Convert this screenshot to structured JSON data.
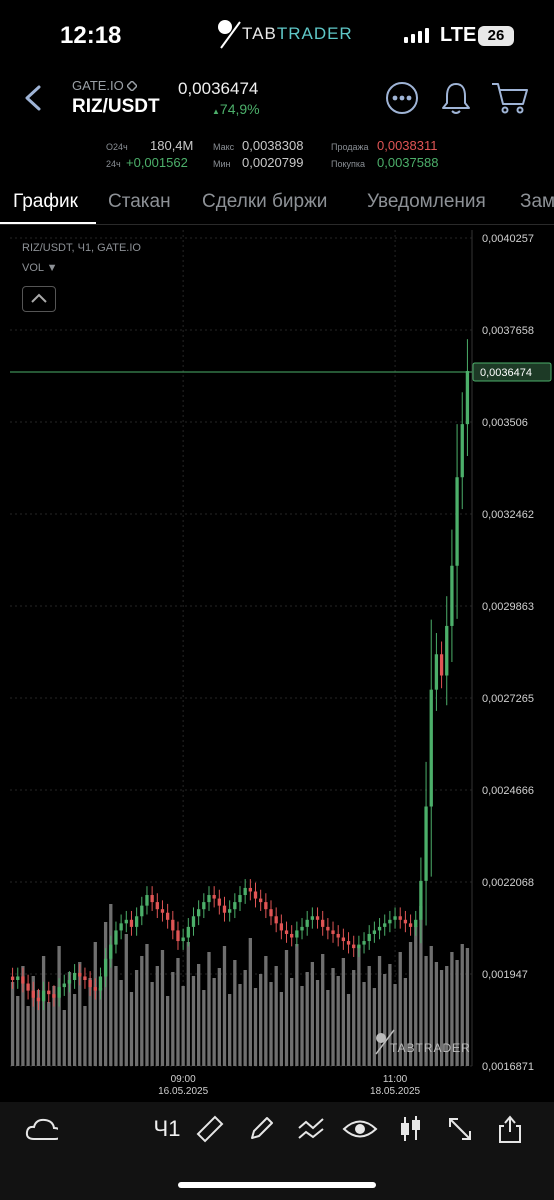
{
  "status_bar": {
    "time": "12:18",
    "network": "LTE",
    "battery": "26"
  },
  "brand": {
    "part1": "TAB",
    "part2": "TRADER"
  },
  "header": {
    "exchange": "GATE.IO",
    "pair": "RIZ/USDT",
    "price": "0,0036474",
    "change": "74,9%"
  },
  "stats": {
    "vol_label": "О24ч",
    "vol_value": "180,4M",
    "chg_label": "24ч",
    "chg_value": "+0,001562",
    "max_label": "Макс",
    "max_value": "0,0038308",
    "min_label": "Мин",
    "min_value": "0,0020799",
    "sell_label": "Продажа",
    "sell_value": "0,0038311",
    "buy_label": "Покупка",
    "buy_value": "0,0037588"
  },
  "tabs": [
    "График",
    "Стакан",
    "Сделки биржи",
    "Уведомления",
    "Зам"
  ],
  "chart_overlay": {
    "instrument": "RIZ/USDT, Ч1, GATE.IO",
    "vol": "VOL ▼",
    "watermark": "TABTRADER"
  },
  "colors": {
    "up": "#4caf6a",
    "down": "#e05555",
    "price_line": "#4caf6a",
    "volume": "#6f6f6f"
  },
  "chart_data": {
    "type": "candlestick",
    "y_ticks": [
      "0,0040257",
      "0,0037658",
      "0,003506",
      "0,0032462",
      "0,0029863",
      "0,0027265",
      "0,0024666",
      "0,0022068",
      "0,001947",
      "0,0016871"
    ],
    "y_tick_values": [
      0.0040257,
      0.0037658,
      0.003506,
      0.0032462,
      0.0029863,
      0.0027265,
      0.0024666,
      0.0022068,
      0.001947,
      0.0016871
    ],
    "ylim": [
      0.0016871,
      0.0040257
    ],
    "current_price_label": "0,0036474",
    "current_price_value": 0.0036474,
    "x_ticks": [
      {
        "time": "09:00",
        "date": "16.05.2025",
        "index": 33
      },
      {
        "time": "11:00",
        "date": "18.05.2025",
        "index": 74
      }
    ],
    "closes": [
      0.00193,
      0.00194,
      0.00192,
      0.0019,
      0.00188,
      0.00187,
      0.0019,
      0.00189,
      0.00188,
      0.00191,
      0.00192,
      0.00193,
      0.00195,
      0.00194,
      0.00193,
      0.00191,
      0.0019,
      0.00194,
      0.00199,
      0.00203,
      0.00207,
      0.00209,
      0.0021,
      0.00208,
      0.00211,
      0.00214,
      0.00217,
      0.00215,
      0.00213,
      0.00212,
      0.0021,
      0.00207,
      0.00204,
      0.00205,
      0.00208,
      0.00211,
      0.00213,
      0.00215,
      0.00217,
      0.00216,
      0.00214,
      0.00212,
      0.00213,
      0.00215,
      0.00217,
      0.00219,
      0.00218,
      0.00216,
      0.00215,
      0.00213,
      0.00211,
      0.00209,
      0.00207,
      0.00206,
      0.00205,
      0.00207,
      0.00208,
      0.0021,
      0.00211,
      0.0021,
      0.00208,
      0.00207,
      0.00206,
      0.00205,
      0.00204,
      0.00203,
      0.00202,
      0.00203,
      0.00204,
      0.00206,
      0.00207,
      0.00208,
      0.00209,
      0.0021,
      0.00211,
      0.0021,
      0.00209,
      0.00208,
      0.0021,
      0.00221,
      0.00242,
      0.00275,
      0.00285,
      0.00279,
      0.00293,
      0.0031,
      0.00335,
      0.0035,
      0.00365
    ],
    "volumes": [
      0.42,
      0.35,
      0.5,
      0.3,
      0.45,
      0.38,
      0.55,
      0.32,
      0.4,
      0.6,
      0.28,
      0.47,
      0.36,
      0.52,
      0.3,
      0.44,
      0.62,
      0.39,
      0.72,
      0.81,
      0.5,
      0.43,
      0.66,
      0.37,
      0.48,
      0.55,
      0.61,
      0.42,
      0.5,
      0.58,
      0.35,
      0.47,
      0.54,
      0.4,
      0.62,
      0.45,
      0.51,
      0.38,
      0.57,
      0.44,
      0.49,
      0.6,
      0.36,
      0.53,
      0.41,
      0.48,
      0.64,
      0.39,
      0.46,
      0.55,
      0.42,
      0.5,
      0.37,
      0.58,
      0.44,
      0.61,
      0.4,
      0.47,
      0.52,
      0.43,
      0.56,
      0.38,
      0.49,
      0.45,
      0.54,
      0.36,
      0.48,
      0.6,
      0.42,
      0.5,
      0.39,
      0.55,
      0.46,
      0.51,
      0.41,
      0.57,
      0.44,
      0.62,
      0.7,
      0.8,
      0.55,
      0.6,
      0.52,
      0.48,
      0.5,
      0.57,
      0.53,
      0.61,
      0.59
    ]
  }
}
